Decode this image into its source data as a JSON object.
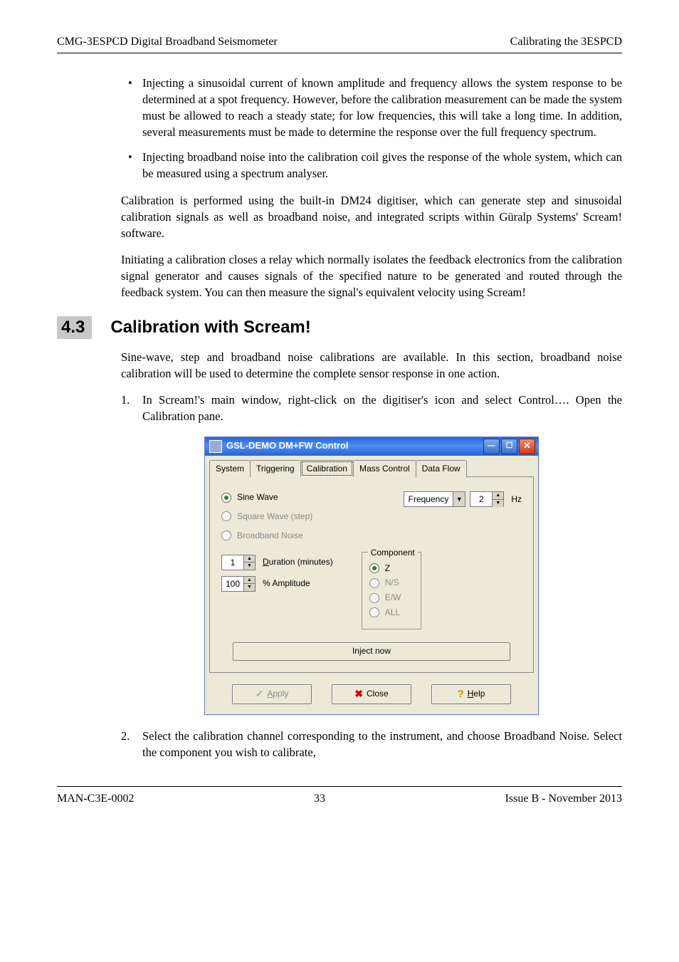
{
  "header": {
    "left": "CMG-3ESPCD Digital Broadband Seismometer",
    "right": "Calibrating the 3ESPCD"
  },
  "bullets": [
    "Injecting a sinusoidal current of known amplitude and frequency allows the system response to be determined at a spot frequency. However, before the calibration measurement can be made the system must be allowed to reach a steady state; for low frequencies, this will take a long time.  In addition, several measurements must be made to determine the response over the full frequency spectrum.",
    "Injecting broadband noise into the calibration coil gives the response of the whole system, which can be measured using a spectrum analyser."
  ],
  "para1": "Calibration is performed using the built-in DM24 digitiser, which can generate step and sinusoidal calibration signals as well as broadband noise, and integrated scripts within Güralp Systems' Scream! software.",
  "para2": "Initiating a calibration closes a relay which normally isolates the feedback electronics from the calibration signal generator and causes signals of the specified nature to be generated and routed through the feedback system.  You can then measure the signal's equivalent velocity using Scream!",
  "section": {
    "num": "4.3",
    "title": "Calibration with Scream!"
  },
  "para3": "Sine-wave, step and broadband noise calibrations are available.  In this section, broadband noise calibration will be used to determine the complete sensor response in one action.",
  "step1_num": "1.",
  "step1": "In Scream!'s main window, right-click on the digitiser's icon and select Control…. Open the Calibration pane.",
  "step2_num": "2.",
  "step2": "Select the calibration channel corresponding to the instrument, and choose Broadband Noise.  Select the component you wish to calibrate,",
  "dialog": {
    "title": "GSL-DEMO DM+FW Control",
    "tabs": [
      "System",
      "Triggering",
      "Calibration",
      "Mass Control",
      "Data Flow"
    ],
    "sine": "Sine Wave",
    "square": "Square Wave (step)",
    "broadband": "Broadband Noise",
    "freq_label": "Frequency",
    "freq_value": "2",
    "hz": "Hz",
    "dur_value": "1",
    "dur_label_pre": "D",
    "dur_label_rest": "uration (minutes)",
    "amp_value": "100",
    "amp_label": "% Amplitude",
    "component_title": "Component",
    "comp_z": "Z",
    "comp_ns": "N/S",
    "comp_ew": "E/W",
    "comp_all": "ALL",
    "inject": "Inject now",
    "apply_pre": "A",
    "apply_rest": "pply",
    "close": "Close",
    "help_pre": "H",
    "help_rest": "elp"
  },
  "footer": {
    "left": "MAN-C3E-0002",
    "center": "33",
    "right": "Issue B  - November 2013"
  }
}
